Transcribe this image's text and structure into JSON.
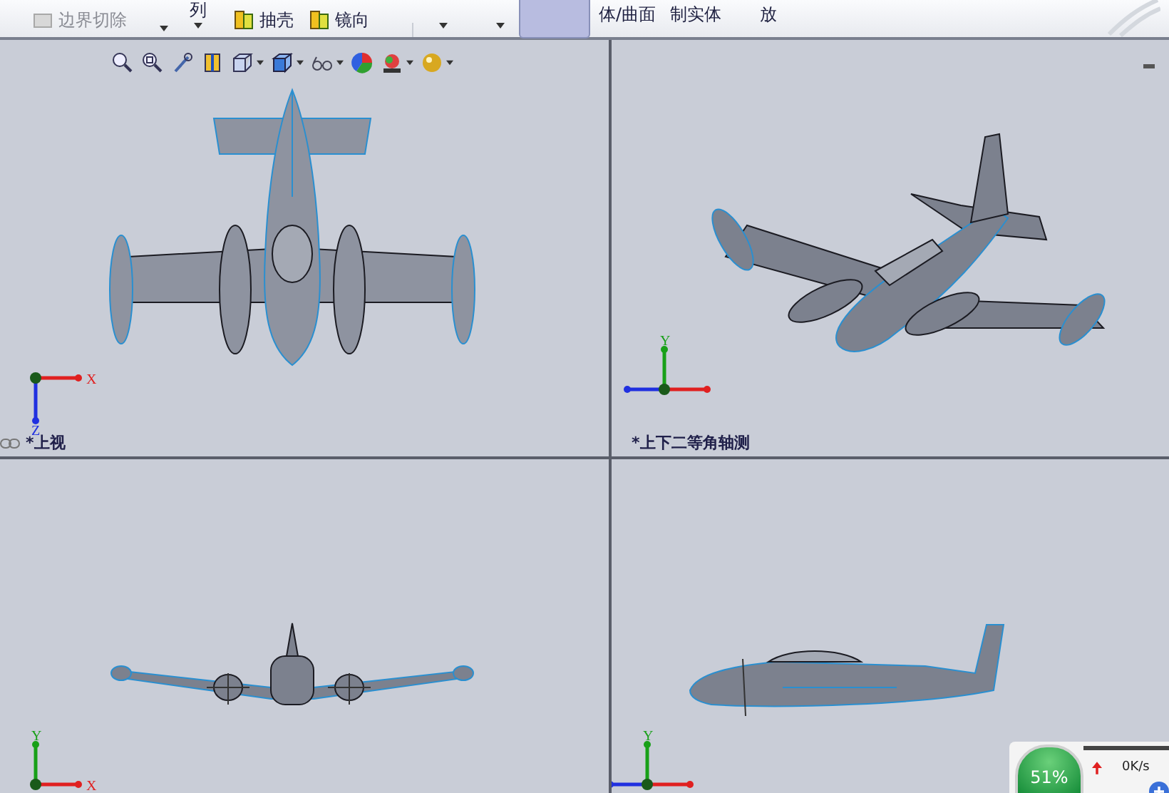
{
  "toolbar": {
    "items": [
      {
        "kind": "small",
        "label": "边界切除",
        "disabled": true
      },
      {
        "kind": "stack",
        "label": "列"
      },
      {
        "kind": "small",
        "label": "抽壳",
        "disabled": false
      },
      {
        "kind": "small",
        "label": "镜向",
        "disabled": false
      },
      {
        "kind": "toggle",
        "on": true
      },
      {
        "kind": "large",
        "label": "体/曲面"
      },
      {
        "kind": "large",
        "label": "制实体"
      },
      {
        "kind": "large",
        "label": "放"
      }
    ]
  },
  "viewports": [
    {
      "kind": "top",
      "label": "*上视",
      "axes": [
        {
          "kind": "right",
          "color": "#e02020",
          "label": "X"
        },
        {
          "kind": "down",
          "color": "#2030e0",
          "label": "Z"
        }
      ]
    },
    {
      "kind": "isometric",
      "label": "*上下二等角轴测",
      "axes": [
        {
          "kind": "up",
          "color": "#18a018",
          "label": "Y"
        },
        {
          "kind": "right",
          "color": "#e02020"
        },
        {
          "kind": "left",
          "color": "#2030e0"
        }
      ]
    },
    {
      "kind": "front",
      "axes": [
        {
          "kind": "up",
          "color": "#18a018",
          "label": "Y"
        },
        {
          "kind": "right",
          "color": "#e02020",
          "label": "X"
        }
      ]
    },
    {
      "kind": "right",
      "axes": [
        {
          "kind": "up",
          "color": "#18a018",
          "label": "Y"
        },
        {
          "kind": "left",
          "color": "#2030e0"
        },
        {
          "kind": "right",
          "color": "#e02020"
        }
      ]
    }
  ],
  "status_widget": {
    "percent": "51%",
    "speed": "0K/s"
  }
}
